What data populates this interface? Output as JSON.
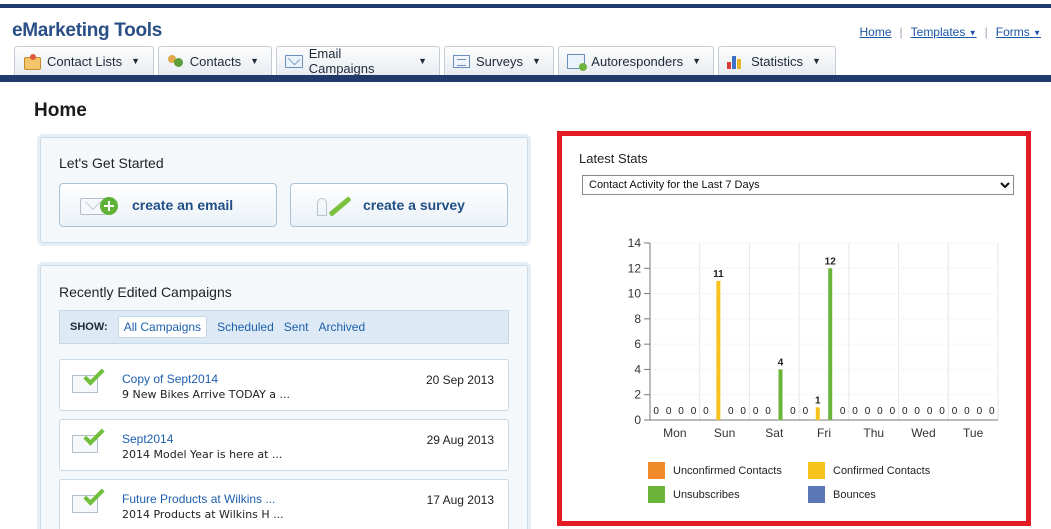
{
  "app": {
    "title": "eMarketing Tools"
  },
  "toplinks": {
    "home": "Home",
    "templates": "Templates",
    "forms": "Forms"
  },
  "tabs": [
    {
      "label": "Contact Lists",
      "icon": "contact-lists-icon"
    },
    {
      "label": "Contacts",
      "icon": "contacts-icon"
    },
    {
      "label": "Email Campaigns",
      "icon": "email-campaigns-icon"
    },
    {
      "label": "Surveys",
      "icon": "surveys-icon"
    },
    {
      "label": "Autoresponders",
      "icon": "autoresponders-icon"
    },
    {
      "label": "Statistics",
      "icon": "statistics-icon"
    }
  ],
  "page": {
    "title": "Home"
  },
  "get_started": {
    "heading": "Let's Get Started",
    "create_email": "create an email",
    "create_survey": "create a survey"
  },
  "recent": {
    "heading": "Recently Edited Campaigns",
    "show_label": "SHOW:",
    "filters": [
      "All Campaigns",
      "Scheduled",
      "Sent",
      "Archived"
    ],
    "active_filter": "All Campaigns",
    "campaigns": [
      {
        "name": "Copy of Sept2014",
        "subject": "9 New Bikes Arrive TODAY a ...",
        "date": "20 Sep 2013"
      },
      {
        "name": "Sept2014",
        "subject": "2014 Model Year is here at ...",
        "date": "29 Aug 2013"
      },
      {
        "name": "Future Products at Wilkins ...",
        "subject": "2014 Products at Wilkins H ...",
        "date": "17 Aug 2013"
      }
    ]
  },
  "stats": {
    "heading": "Latest Stats",
    "period": "Contact Activity for the Last 7 Days",
    "highlight_color": "#e31a23"
  },
  "chart_data": {
    "type": "bar",
    "categories": [
      "Mon",
      "Sun",
      "Sat",
      "Fri",
      "Thu",
      "Wed",
      "Tue"
    ],
    "ylim": [
      0,
      14
    ],
    "yticks": [
      0,
      2,
      4,
      6,
      8,
      10,
      12,
      14
    ],
    "grid": true,
    "legend_position": "bottom",
    "series": [
      {
        "name": "Unconfirmed Contacts",
        "color": "#f08a2a",
        "values": [
          0,
          0,
          0,
          0,
          0,
          0,
          0
        ]
      },
      {
        "name": "Confirmed Contacts",
        "color": "#f7c21b",
        "values": [
          0,
          11,
          0,
          1,
          0,
          0,
          0
        ]
      },
      {
        "name": "Unsubscribes",
        "color": "#6ab43a",
        "values": [
          0,
          0,
          4,
          12,
          0,
          0,
          0
        ]
      },
      {
        "name": "Bounces",
        "color": "#5b77b5",
        "values": [
          0,
          0,
          0,
          0,
          0,
          0,
          0
        ]
      }
    ]
  }
}
